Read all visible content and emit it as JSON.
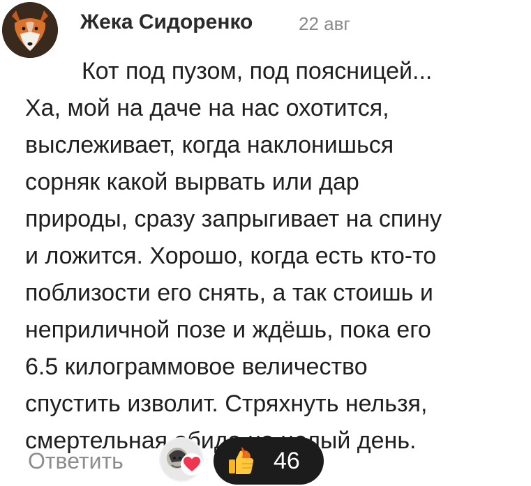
{
  "comment": {
    "author": "Жека Сидоренко",
    "date": "22 авг",
    "lines": [
      "Кот под пузом, под поясницей...",
      "Ха, мой на даче на нас охотится,",
      "выслеживает, когда наклонишься",
      "сорняк какой  вырвать или дар",
      "природы, сразу запрыгивает на спину",
      "и ложится. Хорошо, когда есть кто-то",
      "поблизости его снять, а так стоишь и",
      "неприличной позе и ждёшь, пока его",
      "6.5 килограммовое величество",
      "спустить  изволит. Стряхнуть нельзя,",
      "смертельная обида на целый день."
    ]
  },
  "actions": {
    "reply_label": "Ответить",
    "like_count": "46",
    "heart_color": "#f0364e",
    "pill_color": "#1c1c1c"
  },
  "icons": {
    "avatar": "fox-avatar",
    "liker": "liker-avatar",
    "heart": "heart-icon",
    "like": "thumbs-up-icon"
  }
}
